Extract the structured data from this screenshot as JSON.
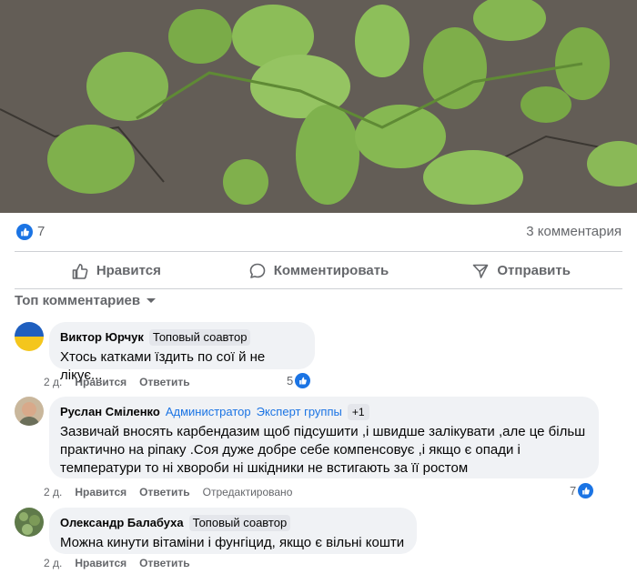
{
  "post": {
    "image_alt_icon": "soybean-plants-photo",
    "like_count": "7",
    "comments_count": "3 комментария"
  },
  "actions": {
    "like": "Нравится",
    "comment": "Комментировать",
    "share": "Отправить"
  },
  "sort_label": "Топ комментариев",
  "comments": [
    {
      "author": "Виктор Юрчук",
      "badges": [
        "Топовый соавтор"
      ],
      "text": "Хтось катками їздить по сої й не лікує...",
      "time": "2 д.",
      "like_label": "Нравится",
      "reply_label": "Ответить",
      "reactions": "5"
    },
    {
      "author": "Руслан Сміленко",
      "badge_admin": "Администратор",
      "badge_expert": "Эксперт группы",
      "badge_plus": "+1",
      "text_lines": [
        "Зазвичай вносять карбендазим щоб підсушити ,і швидше залікувати ,але це більш",
        "практично на ріпаку .Соя дуже добре себе компенсовує ,і якщо є опади і",
        "температури то ні хвороби ні шкідники не встигають за її ростом"
      ],
      "time": "2 д.",
      "like_label": "Нравится",
      "reply_label": "Ответить",
      "edited_label": "Отредактировано",
      "reactions": "7"
    },
    {
      "author": "Олександр Балабуха",
      "badges": [
        "Топовый соавтор"
      ],
      "text": "Можна кинути вітаміни і фунгіцид, якщо є вільні кошти",
      "time": "2 д.",
      "like_label": "Нравится",
      "reply_label": "Ответить"
    }
  ],
  "colors": {
    "accent": "#1b74e4",
    "muted": "#65676b",
    "bubble": "#f0f2f5"
  }
}
